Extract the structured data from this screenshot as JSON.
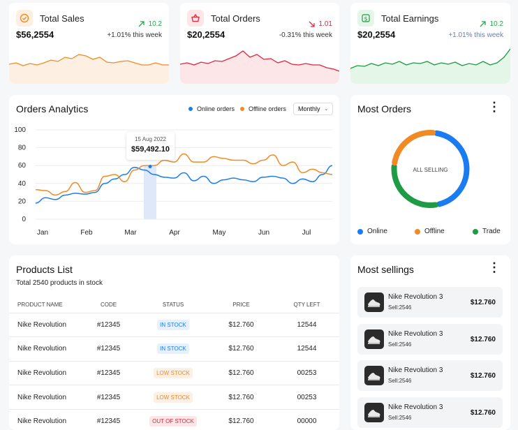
{
  "stats": [
    {
      "title": "Total Sales",
      "value": "$56,2554",
      "delta": "10.2",
      "delta_dir": "up",
      "delta_color": "#22a94a",
      "sub": "+1.01% this week",
      "sub_color": "#333333",
      "accent": "#f08a24",
      "fill": "#fdf0e2",
      "icon": "check-circle-icon"
    },
    {
      "title": "Total Orders",
      "value": "$20,2554",
      "delta": "1.01",
      "delta_dir": "down",
      "delta_color": "#e0263c",
      "sub": "-0.31% this week",
      "sub_color": "#333333",
      "accent": "#e0263c",
      "fill": "#fde6e8",
      "icon": "basket-icon"
    },
    {
      "title": "Total Earnings",
      "value": "$20,2554",
      "delta": "10.2",
      "delta_dir": "up",
      "delta_color": "#22a94a",
      "sub": "+1.01% this week",
      "sub_color": "#6b7fa8",
      "accent": "#1f9a45",
      "fill": "#e3f6e8",
      "icon": "dollar-icon"
    }
  ],
  "analytics": {
    "title": "Orders Analytics",
    "legend_online": "Online orders",
    "legend_offline": "Offline orders",
    "select": "Monthly",
    "tooltip_date": "15 Aug 2022",
    "tooltip_value": "$59,492.10"
  },
  "chart_data": {
    "type": "line",
    "x": [
      "Jan",
      "Feb",
      "Mar",
      "Apr",
      "May",
      "Jun",
      "Jul"
    ],
    "ylim": [
      0,
      100
    ],
    "yticks": [
      "100",
      "80",
      "60",
      "40",
      "20",
      "0"
    ],
    "series": [
      {
        "name": "Online orders",
        "color": "#1a7cf0",
        "values": [
          18,
          24,
          22,
          27,
          29,
          28,
          30,
          40,
          45,
          50,
          58,
          55,
          50,
          47,
          46,
          52,
          43,
          48,
          40,
          44,
          46,
          44,
          42,
          47,
          48,
          46,
          40,
          45,
          42,
          50,
          60
        ]
      },
      {
        "name": "Offline orders",
        "color": "#f08a24",
        "values": [
          33,
          32,
          27,
          31,
          41,
          30,
          32,
          48,
          50,
          42,
          55,
          60,
          60,
          66,
          64,
          73,
          64,
          64,
          70,
          68,
          66,
          66,
          62,
          66,
          72,
          60,
          64,
          52,
          56,
          52,
          50
        ]
      }
    ]
  },
  "most_orders": {
    "title": "Most Orders",
    "center": "ALL SELLING",
    "legend": [
      {
        "label": "Online",
        "color": "#1a7cf0"
      },
      {
        "label": "Offline",
        "color": "#f08a24"
      },
      {
        "label": "Trade",
        "color": "#1f9a45"
      }
    ],
    "segments": [
      {
        "label": "Online",
        "color": "#1a7cf0",
        "value": 0.45
      },
      {
        "label": "Trade",
        "color": "#1f9a45",
        "value": 0.3
      },
      {
        "label": "Offline",
        "color": "#f08a24",
        "value": 0.25
      }
    ]
  },
  "products": {
    "title": "Products List",
    "subtitle": "Total 2540 products in stock",
    "columns": [
      "PRODUCT NAME",
      "CODE",
      "STATUS",
      "PRICE",
      "QTY LEFT"
    ],
    "rows": [
      {
        "name": "Nike Revolution",
        "code": "#12345",
        "status": "IN STOCK",
        "status_color": "#1a7cf0",
        "status_bg": "#e6f1fd",
        "price": "$12.760",
        "qty": "12544"
      },
      {
        "name": "Nike Revolution",
        "code": "#12345",
        "status": "IN STOCK",
        "status_color": "#1a7cf0",
        "status_bg": "#e6f1fd",
        "price": "$12.760",
        "qty": "12544"
      },
      {
        "name": "Nike Revolution",
        "code": "#12345",
        "status": "LOW STOCK",
        "status_color": "#f08a24",
        "status_bg": "#fdf0e2",
        "price": "$12.760",
        "qty": "00253"
      },
      {
        "name": "Nike Revolution",
        "code": "#12345",
        "status": "LOW STOCK",
        "status_color": "#f08a24",
        "status_bg": "#fdf0e2",
        "price": "$12.760",
        "qty": "00253"
      },
      {
        "name": "Nike Revolution",
        "code": "#12345",
        "status": "OUT OF STOCK",
        "status_color": "#e0263c",
        "status_bg": "#fde6e8",
        "price": "$12.760",
        "qty": "00000"
      }
    ]
  },
  "sellings": {
    "title": "Most sellings",
    "items": [
      {
        "name": "Nike Revolution 3",
        "meta": "Sell:2546",
        "price": "$12.760"
      },
      {
        "name": "Nike Revolution 3",
        "meta": "Sell:2546",
        "price": "$12.760"
      },
      {
        "name": "Nike Revolution 3",
        "meta": "Sell:2546",
        "price": "$12.760"
      },
      {
        "name": "Nike Revolution 3",
        "meta": "Sell:2546",
        "price": "$12.760"
      }
    ]
  }
}
